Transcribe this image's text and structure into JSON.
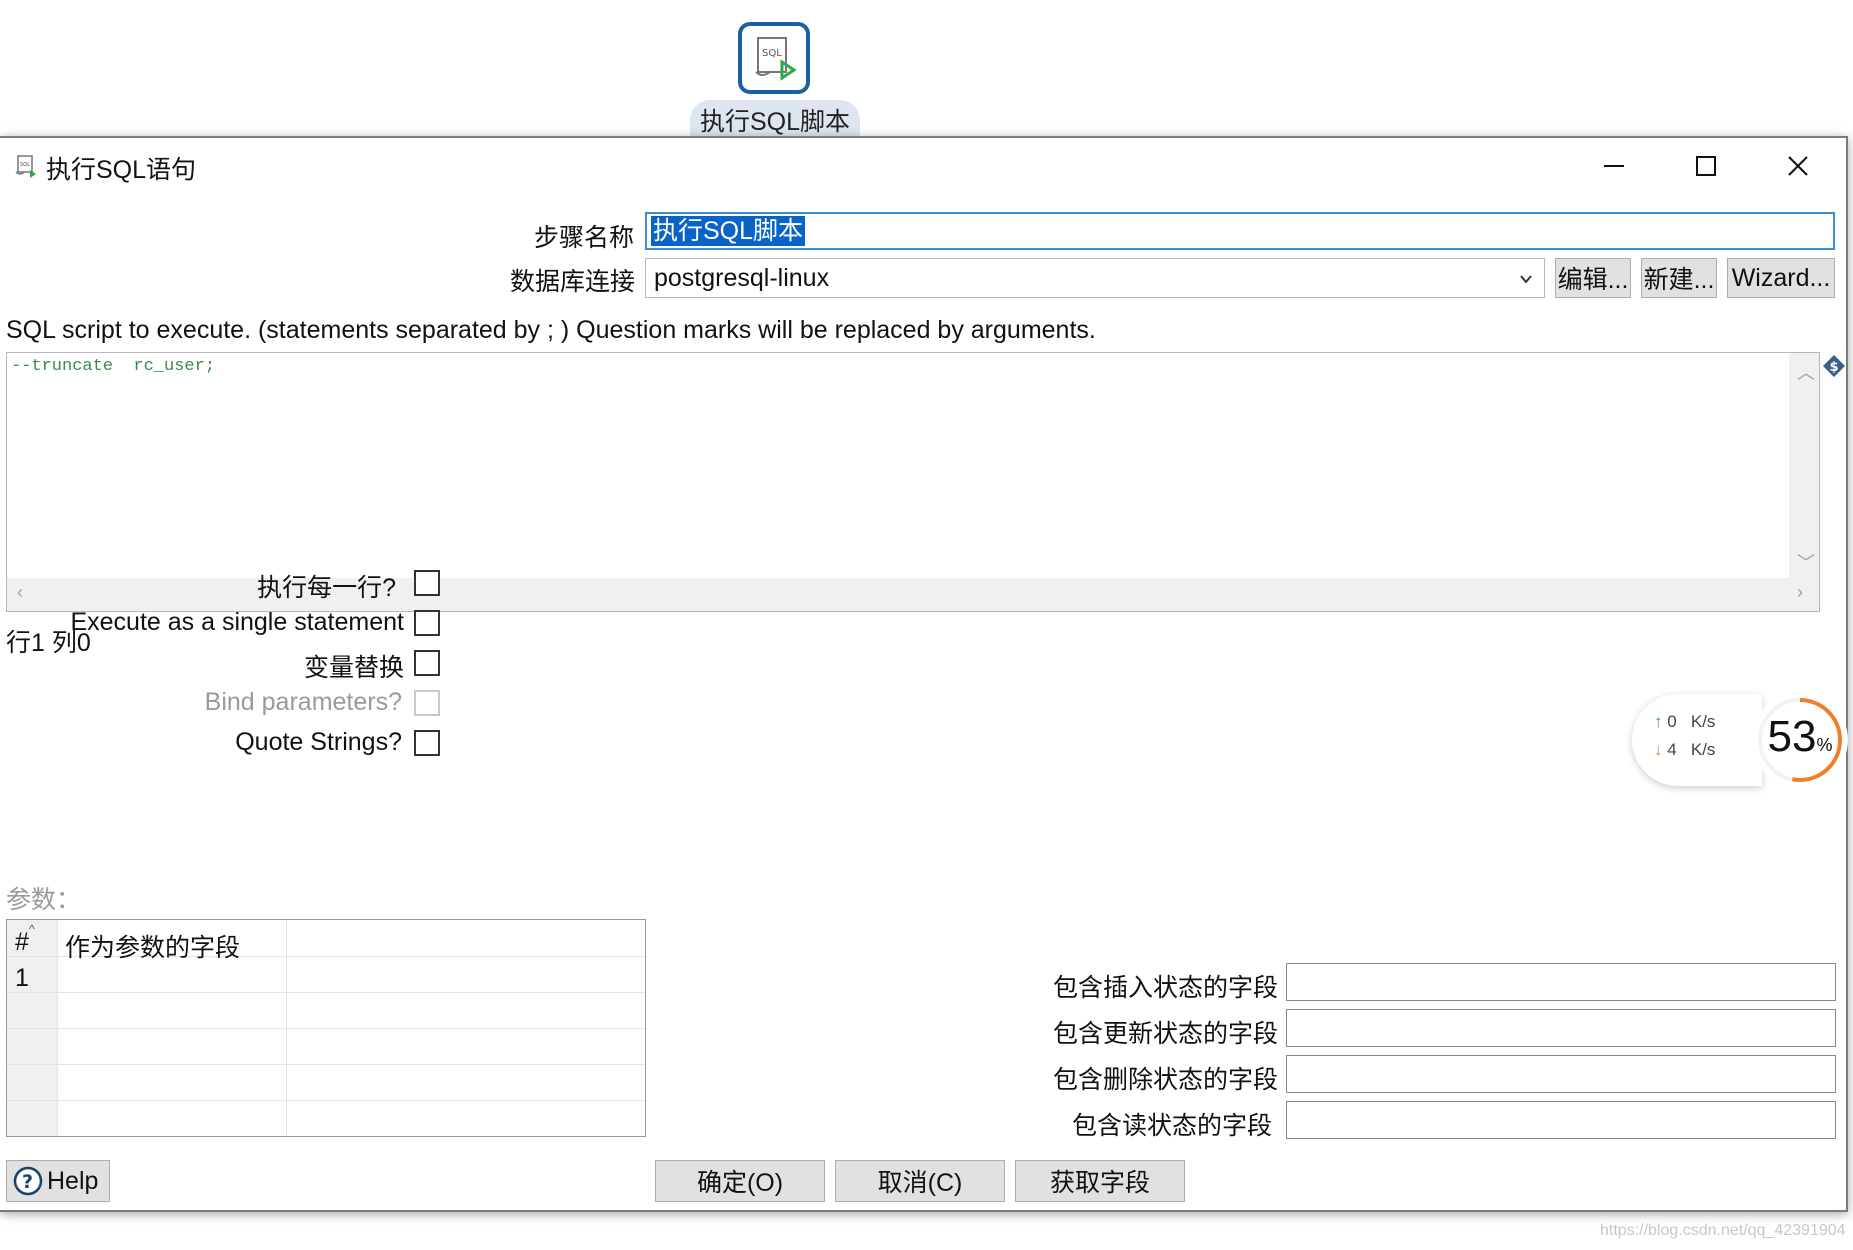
{
  "canvas": {
    "step_label": "执行SQL脚本"
  },
  "dialog": {
    "title": "执行SQL语句",
    "step_name_label": "步骤名称",
    "step_name_value": "执行SQL脚本",
    "connection_label": "数据库连接",
    "connection_value": "postgresql-linux",
    "edit_button": "编辑...",
    "new_button": "新建...",
    "wizard_button": "Wizard...",
    "sql_caption": "SQL script to execute. (statements separated by ; ) Question marks will be replaced by arguments.",
    "sql_text": "--truncate  rc_user;",
    "cursor_position": "行1 列0",
    "options": {
      "execute_each_row": "执行每一行?",
      "single_statement": "Execute as a single statement",
      "variable_substitution": "变量替换",
      "bind_parameters": "Bind parameters?",
      "quote_strings": "Quote Strings?"
    },
    "params_label": "参数：",
    "param_table": {
      "headers": [
        "#",
        "作为参数的字段"
      ],
      "rows": [
        [
          "1",
          ""
        ]
      ]
    },
    "fields": {
      "insert": "包含插入状态的字段",
      "update": "包含更新状态的字段",
      "delete": "包含删除状态的字段",
      "read": "包含读状态的字段"
    },
    "help_button": "Help",
    "ok_button": "确定(O)",
    "cancel_button": "取消(C)",
    "get_fields_button": "获取字段"
  },
  "net_widget": {
    "upload_value": "0",
    "upload_unit": "K/s",
    "download_value": "4",
    "download_unit": "K/s",
    "cpu_percent": "53",
    "percent_sign": "%",
    "cpu_level": 0.53
  },
  "watermark": "https://blog.csdn.net/qq_42391904",
  "colors": {
    "selection": "#0a63c9",
    "focus_border": "#3a8fd6",
    "sql_comment": "#3a8a4a",
    "gauge": "#f07f2a",
    "upload_arrow": "#2ea84a"
  },
  "icons": [
    "sql-script-icon",
    "minimize-icon",
    "maximize-icon",
    "close-icon",
    "chevron-down-icon",
    "variable-icon",
    "help-icon"
  ]
}
